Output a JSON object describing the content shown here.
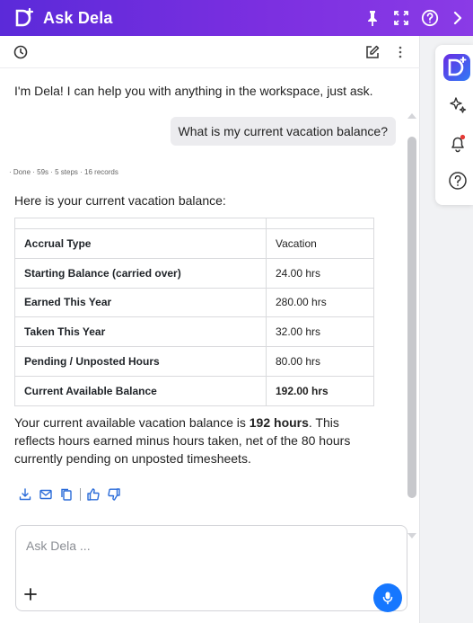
{
  "header": {
    "title": "Ask Dela",
    "icons": [
      "dela-logo-icon",
      "pin-icon",
      "expand-icon",
      "help-icon",
      "chevron-right-icon"
    ]
  },
  "toolbar": {
    "icons": [
      "history-icon",
      "new-chat-icon",
      "more-icon"
    ]
  },
  "chat": {
    "greeting": "I'm Dela! I can help you with anything in the workspace, just ask.",
    "user_message": "What is my current vacation balance?",
    "meta": "· Done · 59s · 5 steps · 16 records",
    "intro": "Here is your current vacation balance:",
    "table": {
      "header": [
        "Accrual Type",
        "Vacation"
      ],
      "rows": [
        [
          "Starting Balance (carried over)",
          "24.00 hrs"
        ],
        [
          "Earned This Year",
          "280.00 hrs"
        ],
        [
          "Taken This Year",
          "32.00 hrs"
        ],
        [
          "Pending / Unposted Hours",
          "80.00 hrs"
        ],
        [
          "Current Available Balance",
          "192.00 hrs"
        ]
      ]
    },
    "summary": {
      "before": "Your current available vacation balance is ",
      "bold": "192 hours",
      "after": ". This reflects hours earned minus hours taken, net of the 80 hours currently pending on unposted timesheets."
    },
    "action_icons": [
      "download-icon",
      "email-icon",
      "copy-icon",
      "thumbs-up-icon",
      "thumbs-down-icon"
    ]
  },
  "composer": {
    "placeholder": "Ask Dela ...",
    "value": ""
  },
  "rail": {
    "icons": [
      "dela-logo-icon",
      "sparkle-icon",
      "notification-bell-icon",
      "help-icon"
    ]
  },
  "colors": {
    "header_start": "#5b2ad9",
    "header_end": "#8a3be6",
    "mic_button": "#1677ff",
    "notification_dot": "#e53935"
  }
}
